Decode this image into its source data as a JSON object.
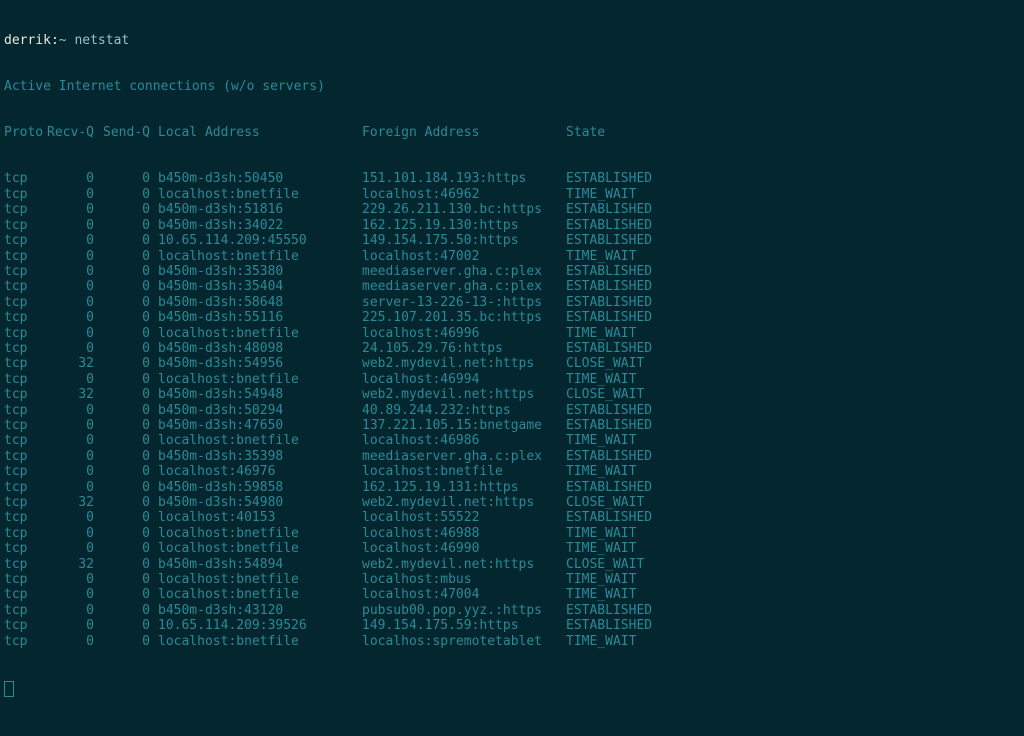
{
  "prompt": {
    "user": "derrik",
    "sep": ":",
    "tilde": "~",
    "command": "netstat"
  },
  "title_line": "Active Internet connections (w/o servers)",
  "headers": {
    "proto": "Proto",
    "recvq": "Recv-Q",
    "sendq": "Send-Q",
    "local": "Local Address",
    "foreign": "Foreign Address",
    "state": "State"
  },
  "rows": [
    {
      "proto": "tcp",
      "recvq": "0",
      "sendq": "0",
      "local": "b450m-d3sh:50450",
      "foreign": "151.101.184.193:https",
      "state": "ESTABLISHED"
    },
    {
      "proto": "tcp",
      "recvq": "0",
      "sendq": "0",
      "local": "localhost:bnetfile",
      "foreign": "localhost:46962",
      "state": "TIME_WAIT"
    },
    {
      "proto": "tcp",
      "recvq": "0",
      "sendq": "0",
      "local": "b450m-d3sh:51816",
      "foreign": "229.26.211.130.bc:https",
      "state": "ESTABLISHED"
    },
    {
      "proto": "tcp",
      "recvq": "0",
      "sendq": "0",
      "local": "b450m-d3sh:34022",
      "foreign": "162.125.19.130:https",
      "state": "ESTABLISHED"
    },
    {
      "proto": "tcp",
      "recvq": "0",
      "sendq": "0",
      "local": "10.65.114.209:45550",
      "foreign": "149.154.175.50:https",
      "state": "ESTABLISHED"
    },
    {
      "proto": "tcp",
      "recvq": "0",
      "sendq": "0",
      "local": "localhost:bnetfile",
      "foreign": "localhost:47002",
      "state": "TIME_WAIT"
    },
    {
      "proto": "tcp",
      "recvq": "0",
      "sendq": "0",
      "local": "b450m-d3sh:35380",
      "foreign": "meediaserver.gha.c:plex",
      "state": "ESTABLISHED"
    },
    {
      "proto": "tcp",
      "recvq": "0",
      "sendq": "0",
      "local": "b450m-d3sh:35404",
      "foreign": "meediaserver.gha.c:plex",
      "state": "ESTABLISHED"
    },
    {
      "proto": "tcp",
      "recvq": "0",
      "sendq": "0",
      "local": "b450m-d3sh:58648",
      "foreign": "server-13-226-13-:https",
      "state": "ESTABLISHED"
    },
    {
      "proto": "tcp",
      "recvq": "0",
      "sendq": "0",
      "local": "b450m-d3sh:55116",
      "foreign": "225.107.201.35.bc:https",
      "state": "ESTABLISHED"
    },
    {
      "proto": "tcp",
      "recvq": "0",
      "sendq": "0",
      "local": "localhost:bnetfile",
      "foreign": "localhost:46996",
      "state": "TIME_WAIT"
    },
    {
      "proto": "tcp",
      "recvq": "0",
      "sendq": "0",
      "local": "b450m-d3sh:48098",
      "foreign": "24.105.29.76:https",
      "state": "ESTABLISHED"
    },
    {
      "proto": "tcp",
      "recvq": "32",
      "sendq": "0",
      "local": "b450m-d3sh:54956",
      "foreign": "web2.mydevil.net:https",
      "state": "CLOSE_WAIT"
    },
    {
      "proto": "tcp",
      "recvq": "0",
      "sendq": "0",
      "local": "localhost:bnetfile",
      "foreign": "localhost:46994",
      "state": "TIME_WAIT"
    },
    {
      "proto": "tcp",
      "recvq": "32",
      "sendq": "0",
      "local": "b450m-d3sh:54948",
      "foreign": "web2.mydevil.net:https",
      "state": "CLOSE_WAIT"
    },
    {
      "proto": "tcp",
      "recvq": "0",
      "sendq": "0",
      "local": "b450m-d3sh:50294",
      "foreign": "40.89.244.232:https",
      "state": "ESTABLISHED"
    },
    {
      "proto": "tcp",
      "recvq": "0",
      "sendq": "0",
      "local": "b450m-d3sh:47650",
      "foreign": "137.221.105.15:bnetgame",
      "state": "ESTABLISHED"
    },
    {
      "proto": "tcp",
      "recvq": "0",
      "sendq": "0",
      "local": "localhost:bnetfile",
      "foreign": "localhost:46986",
      "state": "TIME_WAIT"
    },
    {
      "proto": "tcp",
      "recvq": "0",
      "sendq": "0",
      "local": "b450m-d3sh:35398",
      "foreign": "meediaserver.gha.c:plex",
      "state": "ESTABLISHED"
    },
    {
      "proto": "tcp",
      "recvq": "0",
      "sendq": "0",
      "local": "localhost:46976",
      "foreign": "localhost:bnetfile",
      "state": "TIME_WAIT"
    },
    {
      "proto": "tcp",
      "recvq": "0",
      "sendq": "0",
      "local": "b450m-d3sh:59858",
      "foreign": "162.125.19.131:https",
      "state": "ESTABLISHED"
    },
    {
      "proto": "tcp",
      "recvq": "32",
      "sendq": "0",
      "local": "b450m-d3sh:54980",
      "foreign": "web2.mydevil.net:https",
      "state": "CLOSE_WAIT"
    },
    {
      "proto": "tcp",
      "recvq": "0",
      "sendq": "0",
      "local": "localhost:40153",
      "foreign": "localhost:55522",
      "state": "ESTABLISHED"
    },
    {
      "proto": "tcp",
      "recvq": "0",
      "sendq": "0",
      "local": "localhost:bnetfile",
      "foreign": "localhost:46988",
      "state": "TIME_WAIT"
    },
    {
      "proto": "tcp",
      "recvq": "0",
      "sendq": "0",
      "local": "localhost:bnetfile",
      "foreign": "localhost:46990",
      "state": "TIME_WAIT"
    },
    {
      "proto": "tcp",
      "recvq": "32",
      "sendq": "0",
      "local": "b450m-d3sh:54894",
      "foreign": "web2.mydevil.net:https",
      "state": "CLOSE_WAIT"
    },
    {
      "proto": "tcp",
      "recvq": "0",
      "sendq": "0",
      "local": "localhost:bnetfile",
      "foreign": "localhost:mbus",
      "state": "TIME_WAIT"
    },
    {
      "proto": "tcp",
      "recvq": "0",
      "sendq": "0",
      "local": "localhost:bnetfile",
      "foreign": "localhost:47004",
      "state": "TIME_WAIT"
    },
    {
      "proto": "tcp",
      "recvq": "0",
      "sendq": "0",
      "local": "b450m-d3sh:43120",
      "foreign": "pubsub00.pop.yyz.:https",
      "state": "ESTABLISHED"
    },
    {
      "proto": "tcp",
      "recvq": "0",
      "sendq": "0",
      "local": "10.65.114.209:39526",
      "foreign": "149.154.175.59:https",
      "state": "ESTABLISHED"
    },
    {
      "proto": "tcp",
      "recvq": "0",
      "sendq": "0",
      "local": "localhost:bnetfile",
      "foreign": "localhos:spremotetablet",
      "state": "TIME_WAIT"
    }
  ]
}
